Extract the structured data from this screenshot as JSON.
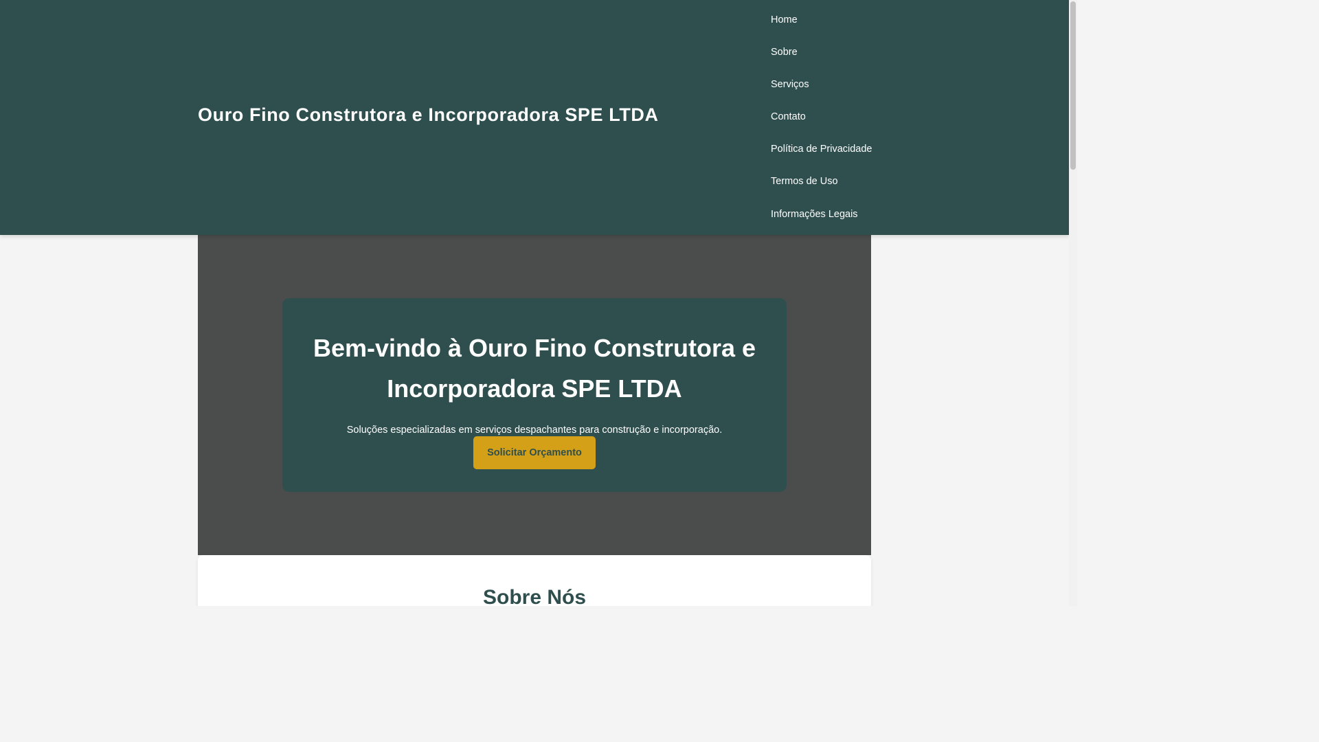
{
  "header": {
    "site_title": "Ouro Fino Construtora e Incorporadora SPE LTDA",
    "nav": [
      {
        "label": "Home"
      },
      {
        "label": "Sobre"
      },
      {
        "label": "Serviços"
      },
      {
        "label": "Contato"
      },
      {
        "label": "Política de Privacidade"
      },
      {
        "label": "Termos de Uso"
      },
      {
        "label": "Informações Legais"
      }
    ]
  },
  "hero": {
    "heading": "Bem-vindo à Ouro Fino Construtora e Incorporadora SPE LTDA",
    "subtitle": "Soluções especializadas em serviços despachantes para construção e incorporação.",
    "cta_label": "Solicitar Orçamento"
  },
  "about": {
    "heading": "Sobre Nós"
  },
  "colors": {
    "header_bg": "#2f4f4f",
    "hero_bg": "#4a4d4c",
    "accent": "#d4a017",
    "text_light": "#ffffff"
  }
}
